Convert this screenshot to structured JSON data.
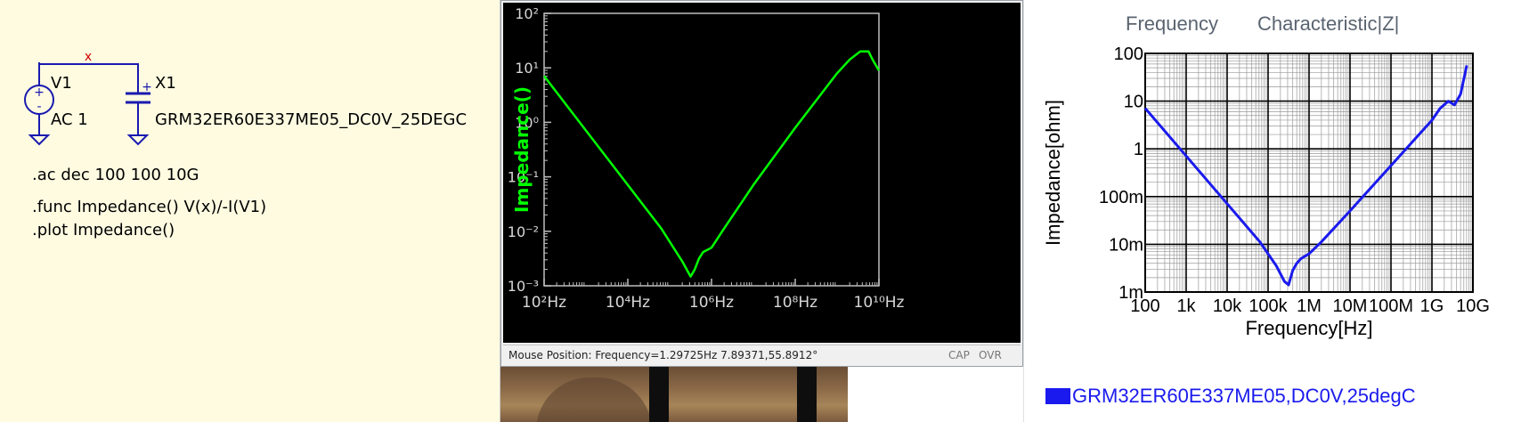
{
  "schematic": {
    "source_name": "V1",
    "source_value": "AC 1",
    "part_name": "X1",
    "part_value": "GRM32ER60E337ME05_DC0V_25DEGC",
    "node_mark": "x",
    "plus_mark": "+",
    "directives": [
      ".ac dec 100 100 10G",
      ".func Impedance() V(x)/-I(V1)",
      ".plot Impedance()"
    ]
  },
  "plot_window": {
    "status_position": "Mouse Position: Frequency=1.29725Hz   7.89371,55.8912°",
    "status_cap": "CAP",
    "status_ovr": "OVR"
  },
  "right_panel": {
    "title_left": "Frequency",
    "title_right": "Characteristic|Z|",
    "legend": "GRM32ER60E337ME05,DC0V,25degC"
  },
  "chart_data": [
    {
      "type": "line",
      "ylabel": "Impedance()",
      "x_ticks": [
        "10²Hz",
        "10⁴Hz",
        "10⁶Hz",
        "10⁸Hz",
        "10¹⁰Hz"
      ],
      "y_ticks": [
        "10⁻³",
        "10⁻²",
        "10⁻¹",
        "10⁰",
        "10¹",
        "10²"
      ],
      "x_log_range": [
        2,
        10
      ],
      "y_log_range": [
        -3,
        2
      ],
      "series": [
        {
          "color": "#00ff00",
          "x_log": [
            2,
            3,
            4,
            4.8,
            5.3,
            5.5,
            5.6,
            5.7,
            5.8,
            6.0,
            6.3,
            7,
            8,
            9,
            9.3,
            9.55,
            9.75,
            9.85,
            10
          ],
          "y_log": [
            0.85,
            -0.15,
            -1.15,
            -1.95,
            -2.55,
            -2.83,
            -2.7,
            -2.5,
            -2.38,
            -2.3,
            -1.95,
            -1.15,
            -0.1,
            0.9,
            1.15,
            1.3,
            1.3,
            1.15,
            0.95
          ]
        }
      ]
    },
    {
      "type": "line",
      "xlabel": "Frequency[Hz]",
      "ylabel": "Impedance[ohm]",
      "x_ticks": [
        "100",
        "1k",
        "10k",
        "100k",
        "1M",
        "10M",
        "100M",
        "1G",
        "10G"
      ],
      "y_ticks": [
        "1m",
        "10m",
        "100m",
        "1",
        "10",
        "100"
      ],
      "x_log_range": [
        2,
        10
      ],
      "y_log_range": [
        -3,
        2
      ],
      "grid": true,
      "series": [
        {
          "name": "GRM32ER60E337ME05,DC0V,25degC",
          "color": "#1a1aee",
          "x_log": [
            2,
            3,
            4,
            4.8,
            5.2,
            5.4,
            5.5,
            5.6,
            5.7,
            5.8,
            6.0,
            6.3,
            7,
            8,
            9,
            9.2,
            9.4,
            9.55,
            9.7,
            9.85
          ],
          "y_log": [
            0.85,
            -0.15,
            -1.15,
            -1.95,
            -2.45,
            -2.78,
            -2.85,
            -2.55,
            -2.4,
            -2.3,
            -2.2,
            -1.95,
            -1.3,
            -0.35,
            0.6,
            0.85,
            1.0,
            0.92,
            1.15,
            1.75
          ]
        }
      ]
    }
  ]
}
